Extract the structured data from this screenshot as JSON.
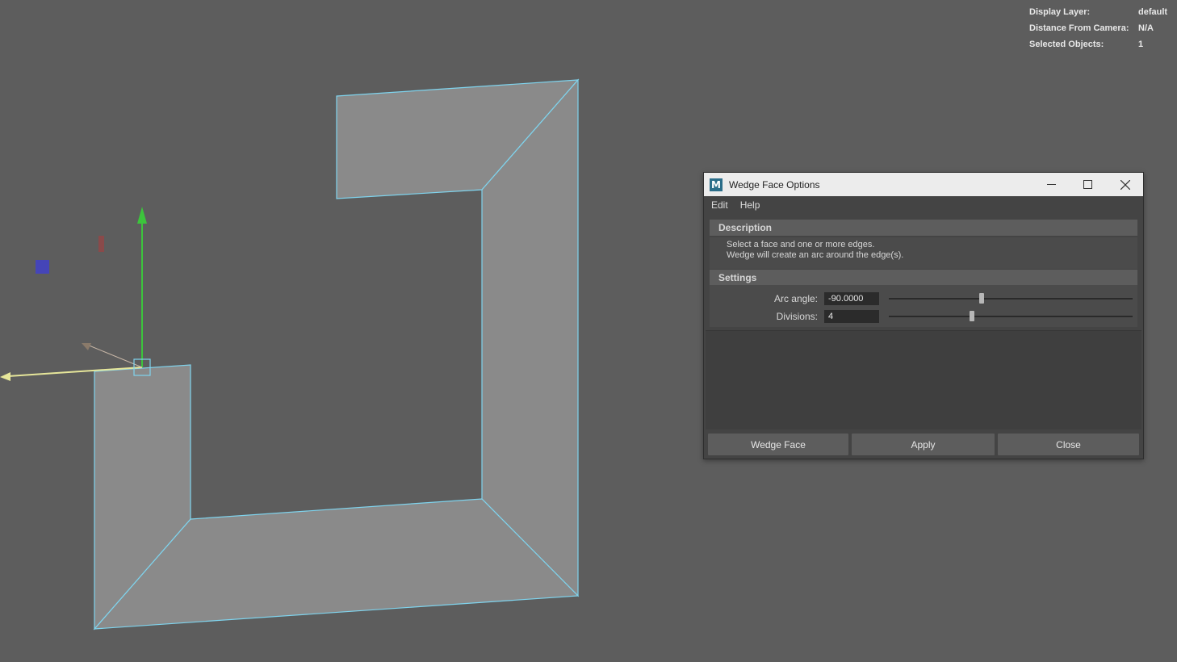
{
  "hud": {
    "display_layer_label": "Display Layer:",
    "display_layer_value": "default",
    "distance_label": "Distance From Camera:",
    "distance_value": "N/A",
    "selected_label": "Selected Objects:",
    "selected_value": "1"
  },
  "dialog": {
    "app_icon": "M",
    "title": "Wedge Face Options",
    "menu": {
      "edit": "Edit",
      "help": "Help"
    },
    "description_header": "Description",
    "description_line1": "Select a face and one or more edges.",
    "description_line2": "Wedge will create an arc around the edge(s).",
    "settings_header": "Settings",
    "arc_angle_label": "Arc angle:",
    "arc_angle_value": "-90.0000",
    "arc_angle_slider_fraction": 0.38,
    "divisions_label": "Divisions:",
    "divisions_value": "4",
    "divisions_slider_fraction": 0.34,
    "buttons": {
      "wedge_face": "Wedge Face",
      "apply": "Apply",
      "close": "Close"
    }
  },
  "colors": {
    "viewport_bg": "#5d5d5d",
    "mesh_fill": "#8a8a8a",
    "mesh_edge": "#7fd4ee",
    "y_axis": "#3cc43c",
    "x_axis": "#e6e69a",
    "dialog_bg": "#444444"
  },
  "icons": [
    "minimize-icon",
    "maximize-icon",
    "close-icon",
    "app-logo-icon"
  ]
}
